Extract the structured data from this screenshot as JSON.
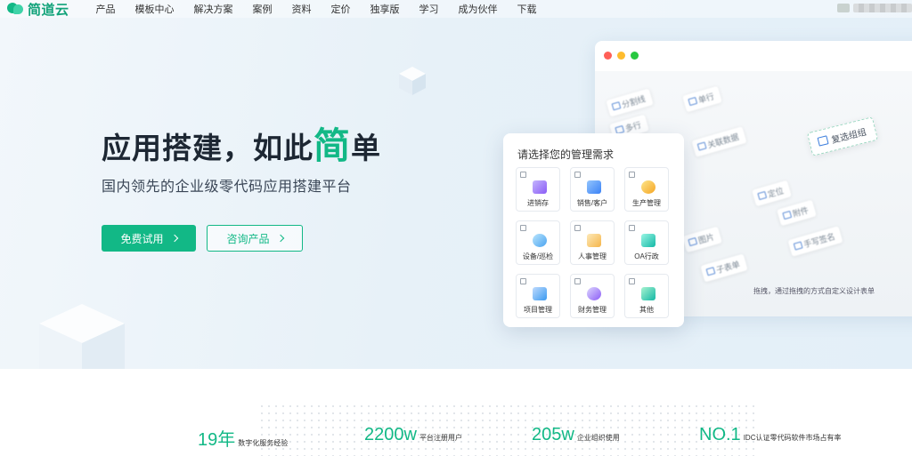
{
  "brand": {
    "name": "简道云",
    "accent": "#12b886"
  },
  "nav": {
    "items": [
      "产品",
      "模板中心",
      "解决方案",
      "案例",
      "资料",
      "定价",
      "独享版",
      "学习",
      "成为伙伴",
      "下载"
    ]
  },
  "hero": {
    "title_pre": "应用搭建，如此",
    "title_accent": "简",
    "title_post": "单",
    "subtitle": "国内领先的企业级零代码应用搭建平台",
    "primary_button": "免费试用",
    "secondary_button": "咨询产品"
  },
  "mock": {
    "window_dots": [
      "#ff5f57",
      "#febc2e",
      "#28c840"
    ],
    "multi_select_label": "复选组组",
    "hint": "拖拽，通过拖拽的方式自定义设计表单",
    "chips": [
      "分割线",
      "手写签名",
      "附件",
      "图片",
      "子表单",
      "关联数据",
      "定位",
      "单行",
      "多行"
    ]
  },
  "need_card": {
    "title": "请选择您的管理需求",
    "options": [
      {
        "label": "进销存",
        "icon": "cart-icon",
        "color": "#8b5cf6"
      },
      {
        "label": "销售/客户",
        "icon": "chart-icon",
        "color": "#3b82f6"
      },
      {
        "label": "生产管理",
        "icon": "gear-icon",
        "color": "#f5a524"
      },
      {
        "label": "设备/巡检",
        "icon": "magnifier-icon",
        "color": "#4aa3f0"
      },
      {
        "label": "人事管理",
        "icon": "id-card-icon",
        "color": "#f5b54a"
      },
      {
        "label": "OA行政",
        "icon": "office-icon",
        "color": "#14b8a6"
      },
      {
        "label": "项目管理",
        "icon": "folder-icon",
        "color": "#3b9af0"
      },
      {
        "label": "财务管理",
        "icon": "coin-icon",
        "color": "#8b5cf6"
      },
      {
        "label": "其他",
        "icon": "grid-icon",
        "color": "#14b8a6"
      }
    ]
  },
  "stats": [
    {
      "value": "19年",
      "label": "数字化服务经验"
    },
    {
      "value": "2200w",
      "label": "平台注册用户"
    },
    {
      "value": "205w",
      "label": "企业组织使用"
    },
    {
      "value": "NO.1",
      "label": "IDC认证零代码软件市场占有率"
    }
  ]
}
